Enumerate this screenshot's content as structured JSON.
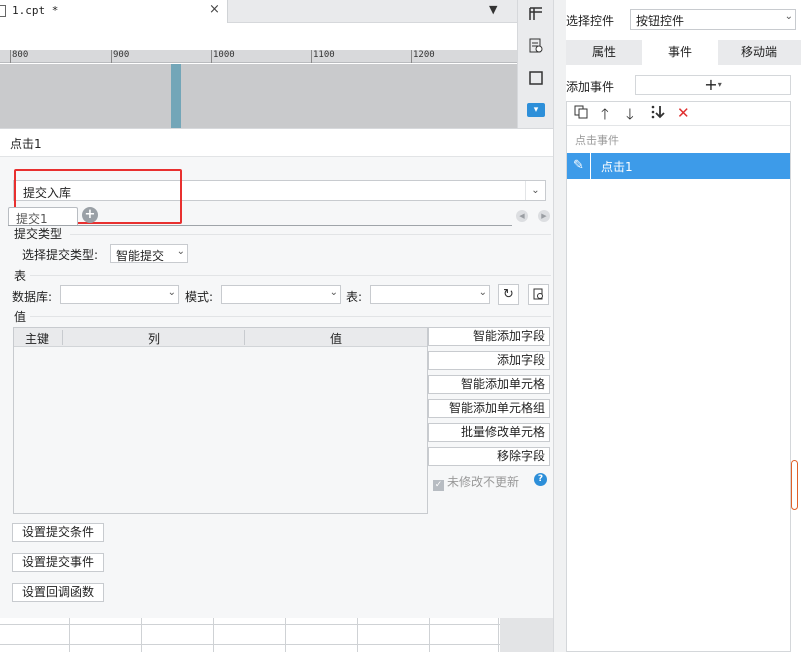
{
  "editor": {
    "doc_tab_title": "1.cpt *",
    "doc_tab_close": "×",
    "tab_menu_icon": "▼",
    "ruler_ticks": [
      "800",
      "900",
      "1000",
      "1100",
      "1200"
    ]
  },
  "dialog": {
    "title": "点击1",
    "submit_type_select": "提交入库",
    "sub_tab_label": "提交1",
    "add_tab_icon": "+",
    "sections": {
      "submit_type": "提交类型",
      "table": "表",
      "value": "值"
    },
    "submit_type_label": "选择提交类型:",
    "submit_type_value": "智能提交",
    "database_label": "数据库:",
    "schema_label": "模式:",
    "table_label": "表:",
    "database_value": "",
    "schema_value": "",
    "table_value": "",
    "grid_headers": [
      "主键",
      "列",
      "值"
    ],
    "actions": [
      "智能添加字段",
      "添加字段",
      "智能添加单元格",
      "智能添加单元格组",
      "批量修改单元格",
      "移除字段"
    ],
    "no_change_label": "未修改不更新",
    "help_icon": "?",
    "bottom_buttons": [
      "设置提交条件",
      "设置提交事件",
      "设置回调函数"
    ]
  },
  "right_panel": {
    "select_widget_label": "选择控件",
    "select_widget_value": "按钮控件",
    "tabs": [
      "属性",
      "事件",
      "移动端"
    ],
    "active_tab": "事件",
    "add_event_label": "添加事件",
    "add_event_icon": "+",
    "add_event_caret": "▾",
    "event_group": "点击事件",
    "event_item": "点击1"
  },
  "colors": {
    "accent": "#3d9be9",
    "highlight_box": "#e8302f",
    "delete": "#e03030"
  }
}
